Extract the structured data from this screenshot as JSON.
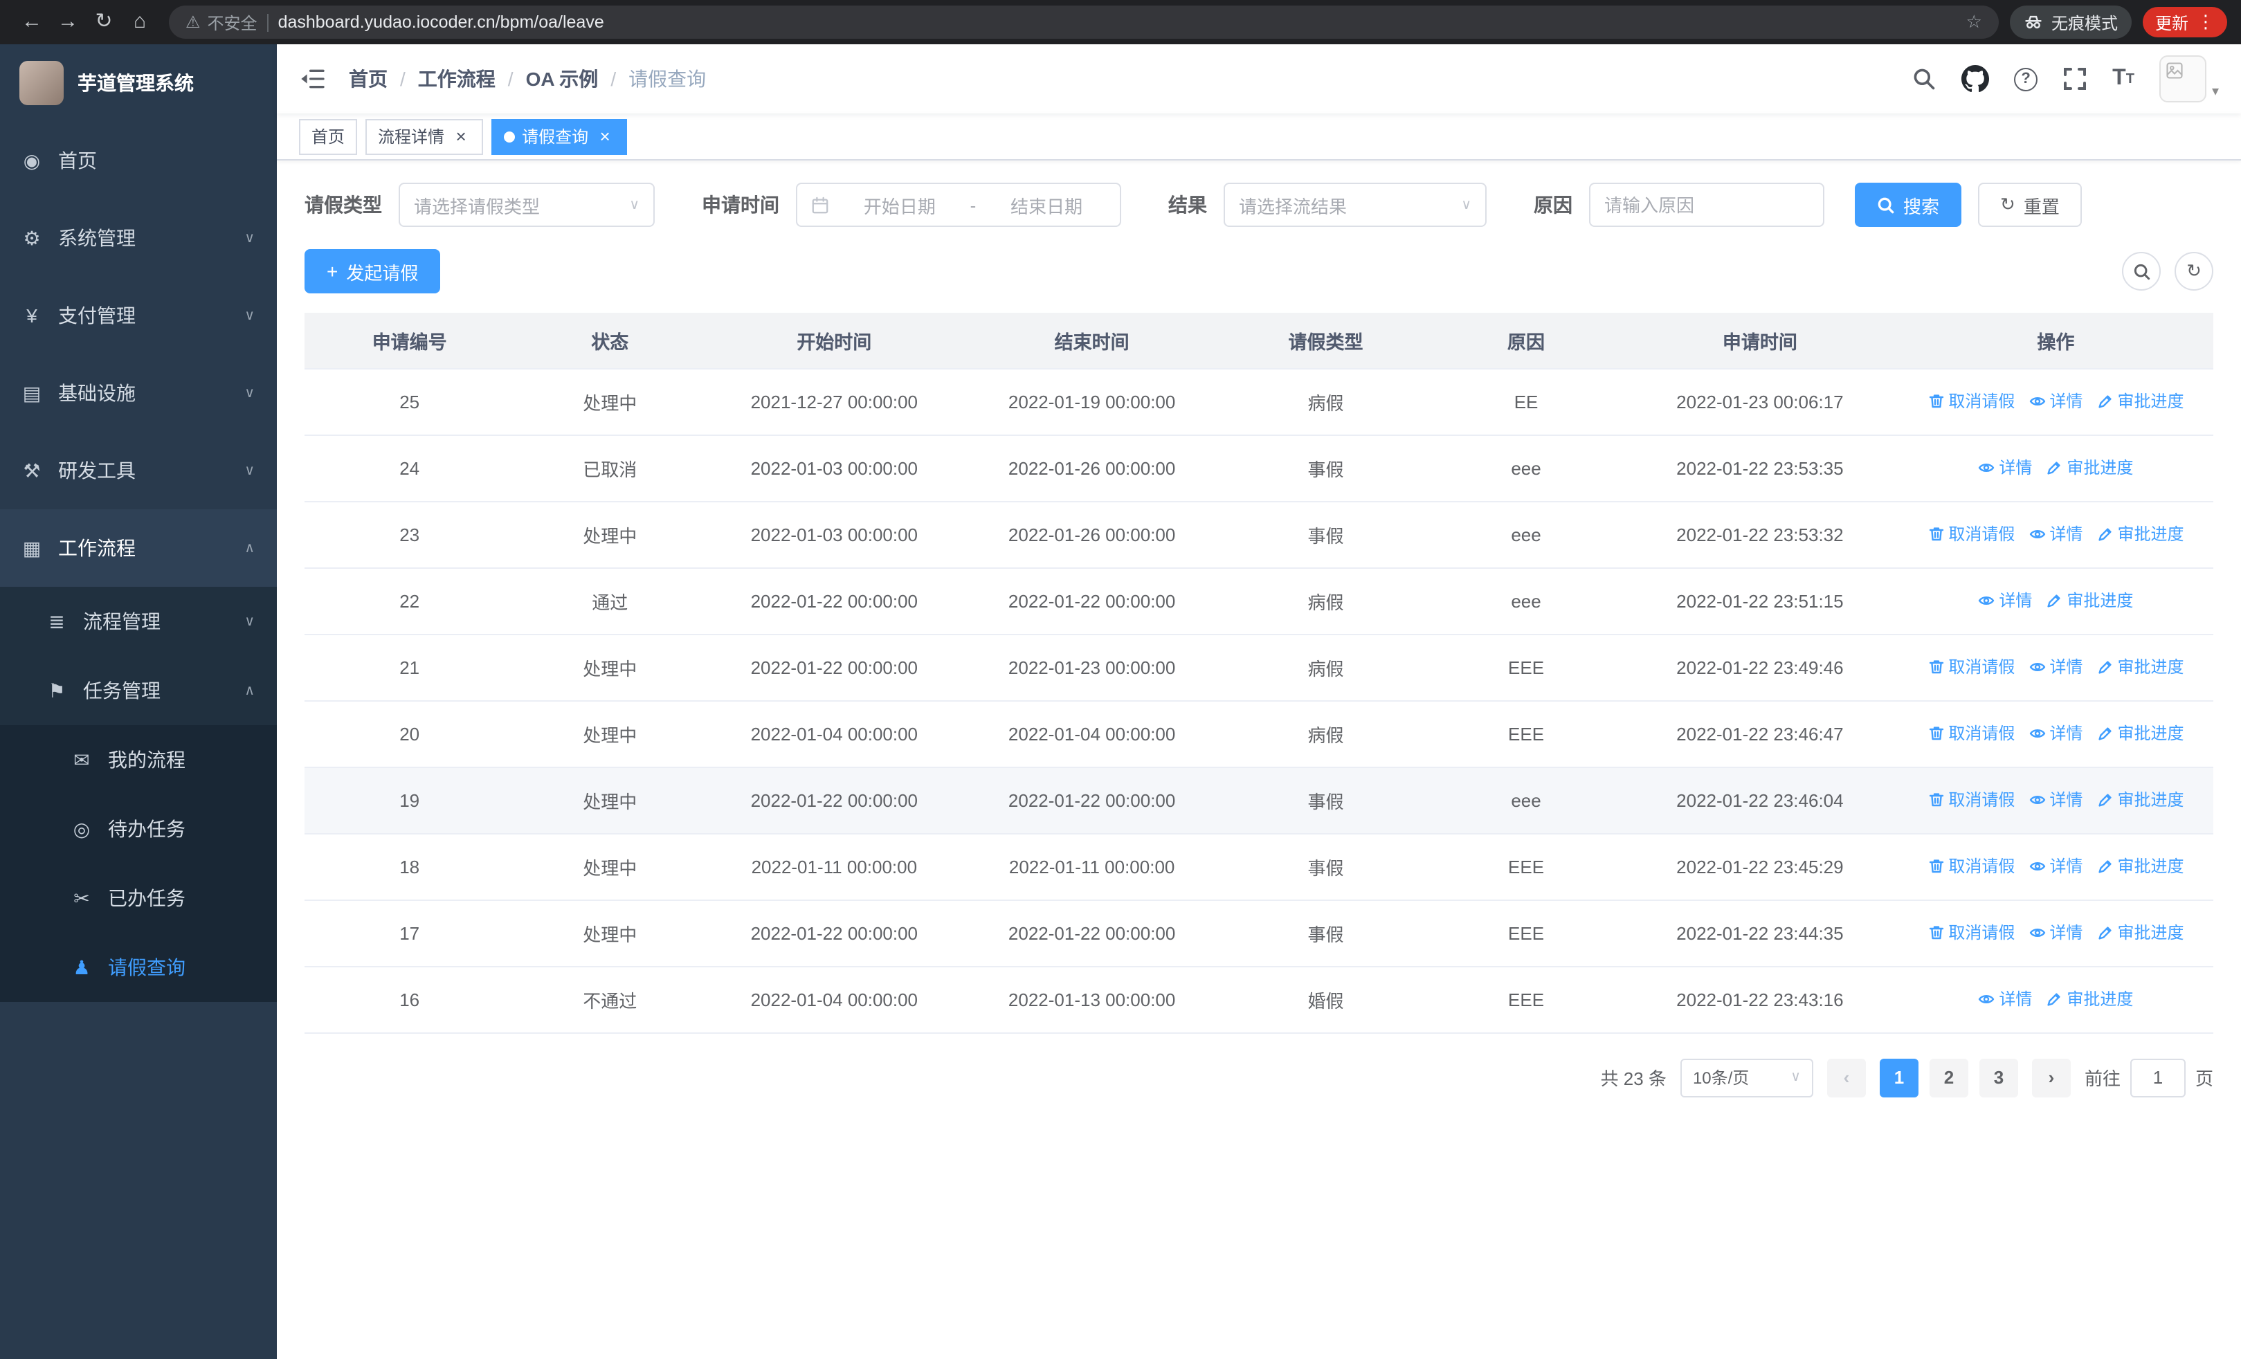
{
  "browser": {
    "security_label": "不安全",
    "url": "dashboard.yudao.iocoder.cn/bpm/oa/leave",
    "incognito_label": "无痕模式",
    "update_label": "更新"
  },
  "icons": {
    "back": "←",
    "forward": "→",
    "reload": "↻",
    "home": "⌂",
    "warning": "⚠",
    "star": "☆",
    "dots": "⋮",
    "chevron_down": "∨",
    "chevron_up": "∧",
    "close": "×",
    "plus": "+",
    "refresh": "↻",
    "help": "?",
    "prev": "‹",
    "next": "›",
    "caret_down": "▾",
    "font_big": "T",
    "font_small": "T"
  },
  "sidebar": {
    "title": "芋道管理系统",
    "items": [
      {
        "label": "首页",
        "icon": "dashboard-icon",
        "glyph": "◉"
      },
      {
        "label": "系统管理",
        "icon": "gear-icon",
        "glyph": "⚙"
      },
      {
        "label": "支付管理",
        "icon": "payment-icon",
        "glyph": "¥"
      },
      {
        "label": "基础设施",
        "icon": "infrastructure-icon",
        "glyph": "▤"
      },
      {
        "label": "研发工具",
        "icon": "devtools-icon",
        "glyph": "⚒"
      },
      {
        "label": "工作流程",
        "icon": "workflow-icon",
        "glyph": "▦",
        "children": [
          {
            "label": "流程管理",
            "icon": "process-management-icon",
            "glyph": "≣"
          },
          {
            "label": "任务管理",
            "icon": "task-management-icon",
            "glyph": "⚑",
            "children": [
              {
                "label": "我的流程",
                "icon": "my-process-icon",
                "glyph": "✉"
              },
              {
                "label": "待办任务",
                "icon": "todo-tasks-icon",
                "glyph": "◎"
              },
              {
                "label": "已办任务",
                "icon": "done-tasks-icon",
                "glyph": "✂"
              },
              {
                "label": "请假查询",
                "icon": "user-icon",
                "glyph": "♟",
                "active": true
              }
            ]
          }
        ]
      }
    ]
  },
  "header": {
    "separator": "/",
    "breadcrumb": [
      "首页",
      "工作流程",
      "OA 示例",
      "请假查询"
    ]
  },
  "tabs": {
    "items": [
      {
        "label": "首页"
      },
      {
        "label": "流程详情",
        "closable": true
      },
      {
        "label": "请假查询",
        "closable": true,
        "active": true
      }
    ]
  },
  "filters": {
    "leave_type": {
      "label": "请假类型",
      "placeholder": "请选择请假类型"
    },
    "apply_time": {
      "label": "申请时间",
      "start_placeholder": "开始日期",
      "separator": "-",
      "end_placeholder": "结束日期"
    },
    "result": {
      "label": "结果",
      "placeholder": "请选择流结果"
    },
    "reason": {
      "label": "原因",
      "placeholder": "请输入原因"
    },
    "search_label": "搜索",
    "reset_label": "重置"
  },
  "toolbar": {
    "create_label": "发起请假"
  },
  "table": {
    "columns": [
      "申请编号",
      "状态",
      "开始时间",
      "结束时间",
      "请假类型",
      "原因",
      "申请时间",
      "操作"
    ],
    "action_labels": {
      "cancel": "取消请假",
      "detail": "详情",
      "progress": "审批进度"
    },
    "rows": [
      {
        "id": "25",
        "status": "处理中",
        "start": "2021-12-27 00:00:00",
        "end": "2022-01-19 00:00:00",
        "type": "病假",
        "reason": "EE",
        "applied": "2022-01-23 00:06:17",
        "actions": [
          "cancel",
          "detail",
          "progress"
        ]
      },
      {
        "id": "24",
        "status": "已取消",
        "start": "2022-01-03 00:00:00",
        "end": "2022-01-26 00:00:00",
        "type": "事假",
        "reason": "eee",
        "applied": "2022-01-22 23:53:35",
        "actions": [
          "detail",
          "progress"
        ]
      },
      {
        "id": "23",
        "status": "处理中",
        "start": "2022-01-03 00:00:00",
        "end": "2022-01-26 00:00:00",
        "type": "事假",
        "reason": "eee",
        "applied": "2022-01-22 23:53:32",
        "actions": [
          "cancel",
          "detail",
          "progress"
        ]
      },
      {
        "id": "22",
        "status": "通过",
        "start": "2022-01-22 00:00:00",
        "end": "2022-01-22 00:00:00",
        "type": "病假",
        "reason": "eee",
        "applied": "2022-01-22 23:51:15",
        "actions": [
          "detail",
          "progress"
        ]
      },
      {
        "id": "21",
        "status": "处理中",
        "start": "2022-01-22 00:00:00",
        "end": "2022-01-23 00:00:00",
        "type": "病假",
        "reason": "EEE",
        "applied": "2022-01-22 23:49:46",
        "actions": [
          "cancel",
          "detail",
          "progress"
        ]
      },
      {
        "id": "20",
        "status": "处理中",
        "start": "2022-01-04 00:00:00",
        "end": "2022-01-04 00:00:00",
        "type": "病假",
        "reason": "EEE",
        "applied": "2022-01-22 23:46:47",
        "actions": [
          "cancel",
          "detail",
          "progress"
        ]
      },
      {
        "id": "19",
        "status": "处理中",
        "start": "2022-01-22 00:00:00",
        "end": "2022-01-22 00:00:00",
        "type": "事假",
        "reason": "eee",
        "applied": "2022-01-22 23:46:04",
        "actions": [
          "cancel",
          "detail",
          "progress"
        ],
        "highlighted": true
      },
      {
        "id": "18",
        "status": "处理中",
        "start": "2022-01-11 00:00:00",
        "end": "2022-01-11 00:00:00",
        "type": "事假",
        "reason": "EEE",
        "applied": "2022-01-22 23:45:29",
        "actions": [
          "cancel",
          "detail",
          "progress"
        ]
      },
      {
        "id": "17",
        "status": "处理中",
        "start": "2022-01-22 00:00:00",
        "end": "2022-01-22 00:00:00",
        "type": "事假",
        "reason": "EEE",
        "applied": "2022-01-22 23:44:35",
        "actions": [
          "cancel",
          "detail",
          "progress"
        ]
      },
      {
        "id": "16",
        "status": "不通过",
        "start": "2022-01-04 00:00:00",
        "end": "2022-01-13 00:00:00",
        "type": "婚假",
        "reason": "EEE",
        "applied": "2022-01-22 23:43:16",
        "actions": [
          "detail",
          "progress"
        ]
      }
    ]
  },
  "pagination": {
    "total": "共 23 条",
    "page_size": "10条/页",
    "pages": [
      "1",
      "2",
      "3"
    ],
    "active_page": "1",
    "goto_label": "前往",
    "goto_value": "1",
    "page_unit": "页"
  },
  "colors": {
    "accent": "#409eff",
    "sidebar_bg": "#293a4d",
    "update_chip": "#d93025"
  }
}
